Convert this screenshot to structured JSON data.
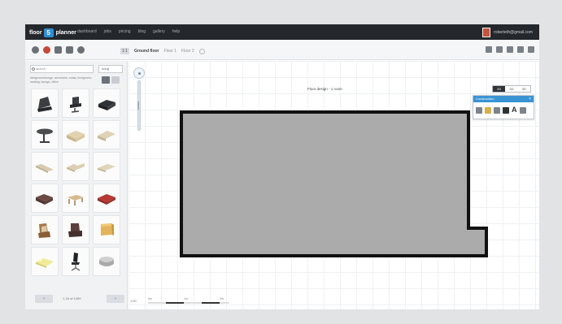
{
  "brand": {
    "part1": "floor",
    "mark": "5",
    "part2": "planner"
  },
  "nav": {
    "links": [
      "dashboard",
      "jobs",
      "pricing",
      "blog",
      "gallery",
      "help"
    ]
  },
  "user": {
    "name": "roberteth@gmail.com"
  },
  "toolbar": {
    "project_label": "1:1",
    "floors": [
      "Ground floor",
      "Floor 1",
      "Floor 2"
    ]
  },
  "sidebar": {
    "search_placeholder": "search",
    "category": "living",
    "tags": "livingroom/lounge, armchairs, sofas, livingroom, seating, lounge, office",
    "items": [
      {
        "name": "armchair-dark"
      },
      {
        "name": "office-chair"
      },
      {
        "name": "sofa-bed-dark"
      },
      {
        "name": "round-table"
      },
      {
        "name": "sofa-beige"
      },
      {
        "name": "sofa-light"
      },
      {
        "name": "chaise-longue"
      },
      {
        "name": "corner-sofa"
      },
      {
        "name": "sofa-flat"
      },
      {
        "name": "sofa-brown"
      },
      {
        "name": "coffee-table"
      },
      {
        "name": "sofa-red"
      },
      {
        "name": "armchair-wood"
      },
      {
        "name": "armchair-brown"
      },
      {
        "name": "cabinet-yellow"
      },
      {
        "name": "bed-yellow"
      },
      {
        "name": "office-chair-black"
      },
      {
        "name": "pouf-grey"
      }
    ],
    "pager": {
      "prev": "‹",
      "count": "1-18 of 1289",
      "next": "›"
    }
  },
  "canvas": {
    "title": "Floor design - 1 room",
    "zoom_label": "zoom",
    "view_modes": [
      "2D",
      "3D",
      "3D"
    ],
    "toolbox_title": "Construction",
    "toolbox_text_tool": "A",
    "scale_label": "1:50",
    "scale_ticks": [
      "0m",
      "1m",
      "2m"
    ]
  },
  "colors": {
    "nav_bg": "#24272b",
    "accent": "#3a93d3",
    "room_fill": "#ababab",
    "room_wall": "#111111"
  }
}
